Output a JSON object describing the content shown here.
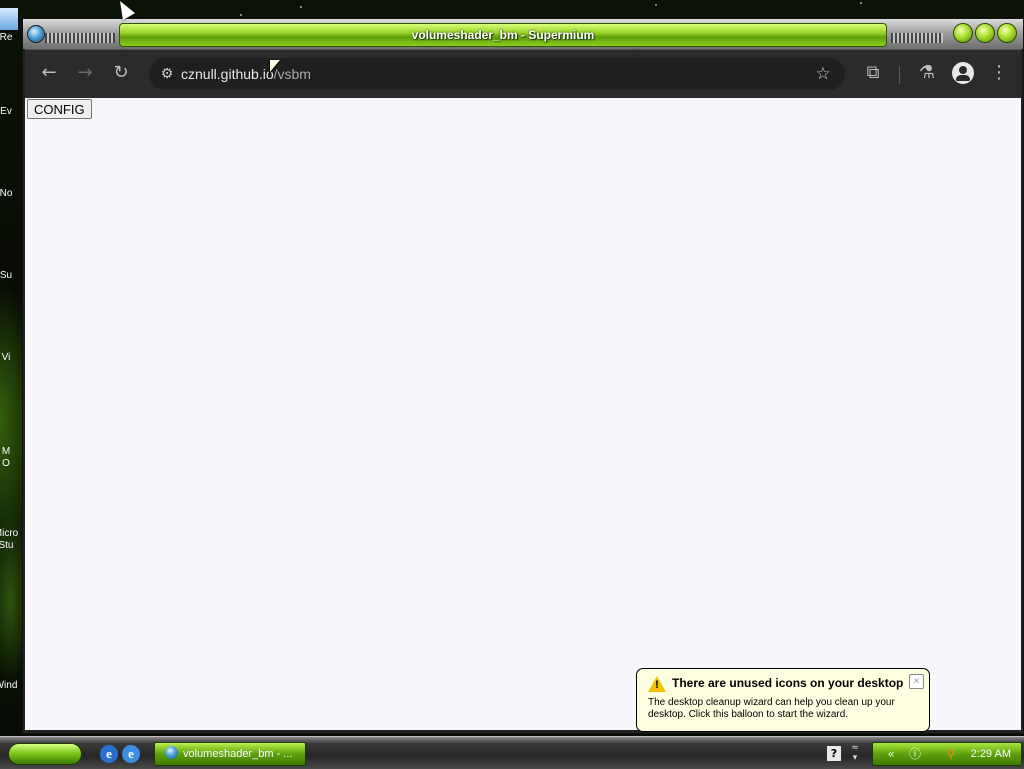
{
  "desktop": {
    "icons": [
      {
        "label": "Re"
      },
      {
        "label": "Ev"
      },
      {
        "label": "No"
      },
      {
        "label": "Su"
      },
      {
        "label": "Vi"
      },
      {
        "label": "M\nO"
      },
      {
        "label": "Micro\nStu"
      },
      {
        "label": "Wind"
      }
    ]
  },
  "window": {
    "title": "volumeshader_bm - Supermium",
    "buttons": [
      "minimize",
      "maximize",
      "close"
    ]
  },
  "browser": {
    "nav": {
      "back_icon": "arrow-left-icon",
      "forward_icon": "arrow-right-icon",
      "reload_icon": "reload-icon"
    },
    "omnibox": {
      "site_info_icon": "tune-icon",
      "url_host": "cznull.github.io",
      "url_path": "/vsbm",
      "bookmark_icon": "star-icon"
    },
    "toolbar_icons": [
      "extensions-icon",
      "labs-flask-icon",
      "profile-icon",
      "menu-icon"
    ]
  },
  "page": {
    "config_button": "CONFIG",
    "background": "#f8f8fc"
  },
  "taskbar": {
    "task_label": "volumeshader_bm - ...",
    "clock": "2:29 AM"
  },
  "balloon": {
    "title": "There are unused icons on your desktop",
    "body": "The desktop cleanup wizard can help you clean up your desktop. Click this balloon to start the wizard.",
    "close": "×"
  },
  "colors": {
    "accent_green": "#7ec81c",
    "chrome_dark": "#2b2b2b",
    "balloon_bg": "#ffffe1"
  }
}
